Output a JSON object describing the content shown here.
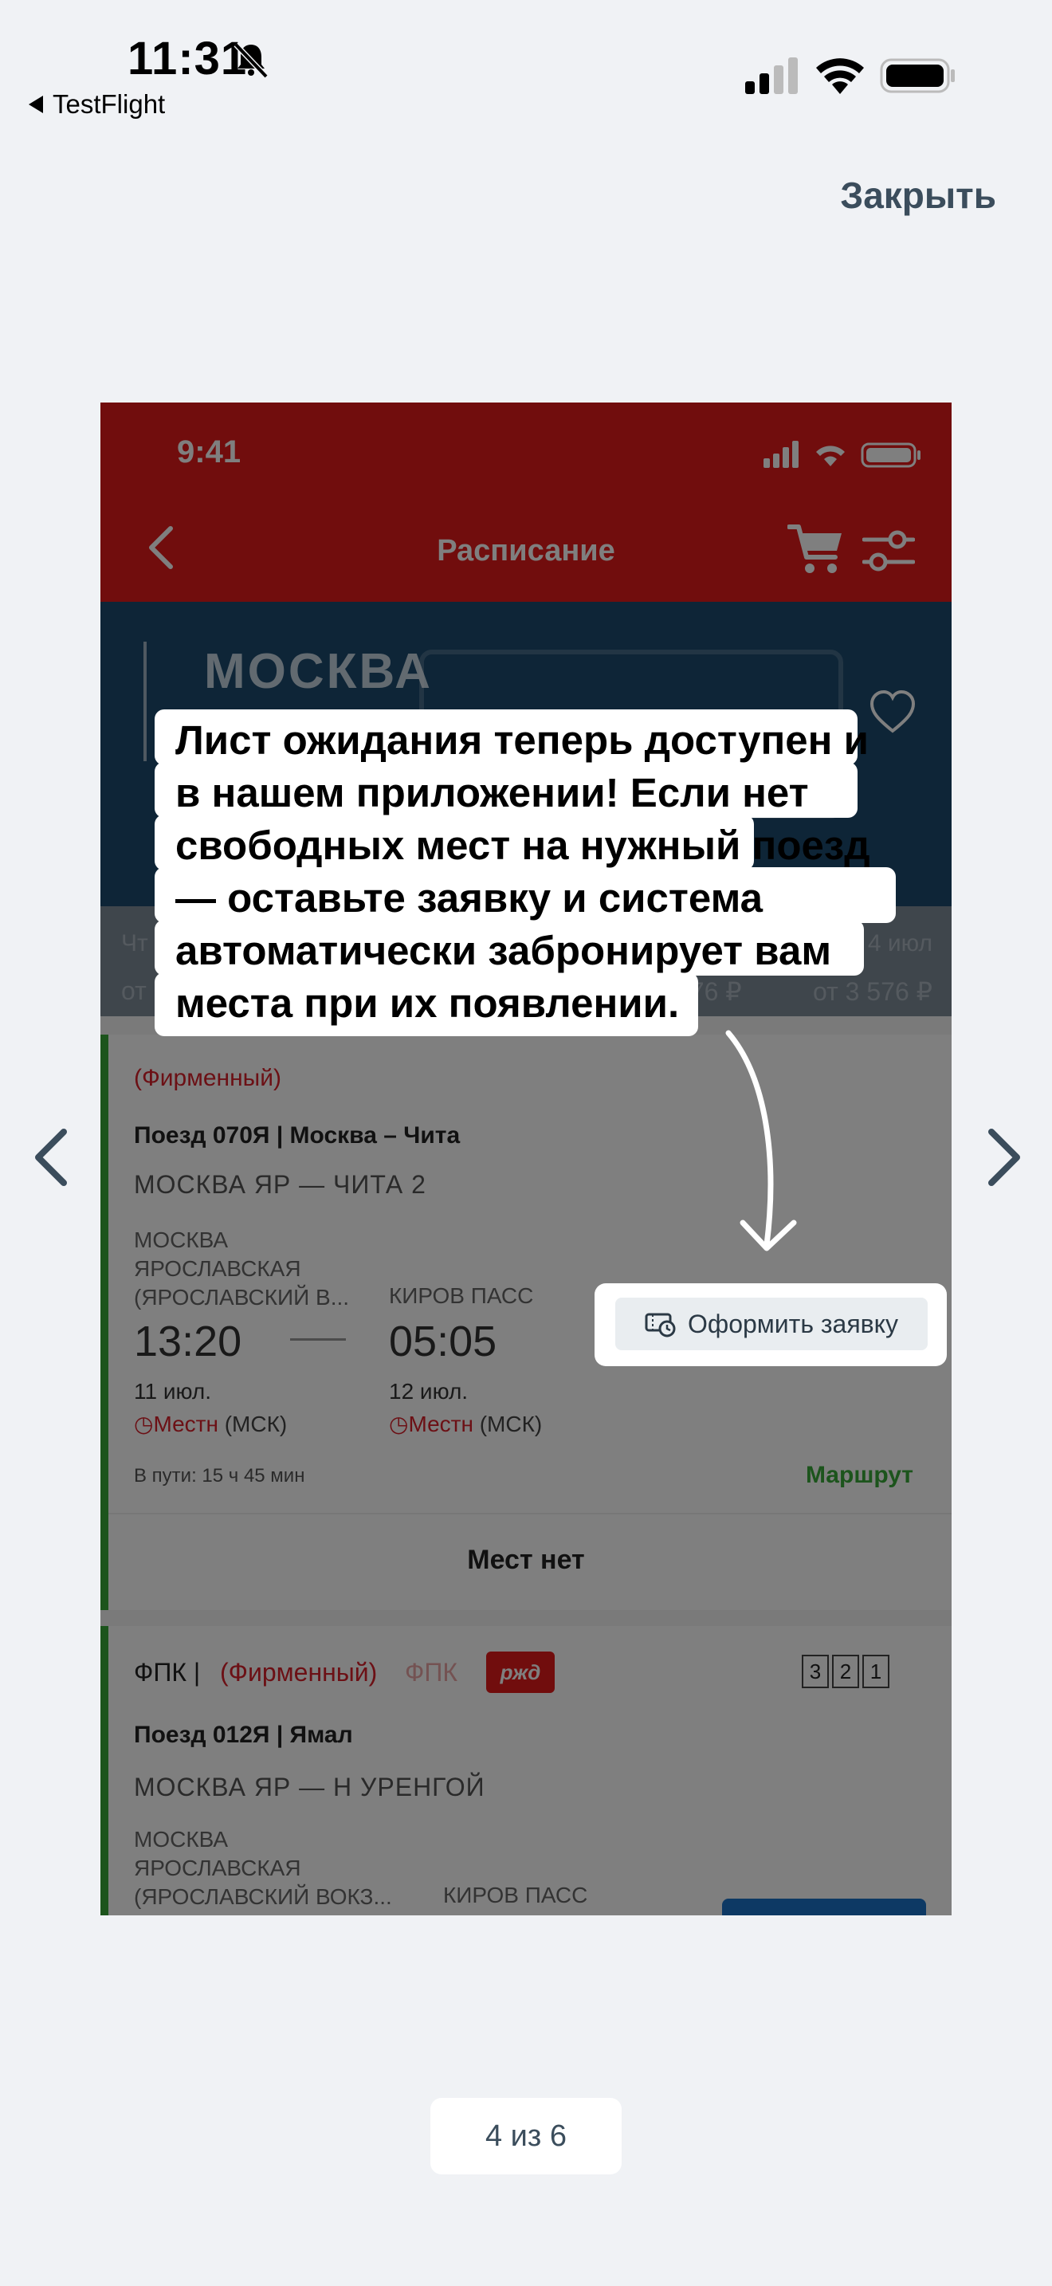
{
  "os_status": {
    "time": "11:31",
    "back_app": "TestFlight"
  },
  "viewer": {
    "close_label": "Закрыть",
    "page_indicator": "4 из 6"
  },
  "screenshot": {
    "status_time": "9:41",
    "header_title": "Расписание",
    "hero_city": "МОСКВА",
    "date_strip": {
      "left_top": "Чт",
      "left_bottom": "от",
      "mid_bottom": "576 ₽",
      "right_top": "4 июл",
      "right_bottom": "от 3 576 ₽"
    },
    "card1": {
      "badge": "(Фирменный)",
      "train": "Поезд 070Я   |   Москва – Чита",
      "route": "МОСКВА ЯР — ЧИТА 2",
      "from_station": "МОСКВА ЯРОСЛАВСКАЯ (ЯРОСЛАВСКИЙ В...",
      "to_station": "КИРОВ ПАСС",
      "dep_time": "13:20",
      "arr_time": "05:05",
      "dep_date": "11 июл.",
      "arr_date": "12 июл.",
      "tz_local": "Местн",
      "tz_msk": " (МСК)",
      "duration": "В пути: 15 ч 45 мин",
      "route_link": "Маршрут",
      "no_seats": "Мест нет"
    },
    "card2": {
      "carrier": "ФПК  |",
      "badge": "(Фирменный)",
      "fpk": "ФПК",
      "logo": "ржд",
      "classes": [
        "3",
        "2",
        "1"
      ],
      "train": "Поезд 012Я   |   Ямал",
      "route": "МОСКВА ЯР — Н УРЕНГОЙ",
      "from_station": "МОСКВА ЯРОСЛАВСКАЯ (ЯРОСЛАВСКИЙ ВОКЗ...",
      "to_station": "КИРОВ ПАСС"
    }
  },
  "callout": {
    "text": "Лист ожидания теперь доступен и в нашем приложении! Если нет свободных мест на нужный поезд — оставьте заявку и система автоматически забронирует вам места при их появлении."
  },
  "cta": {
    "label": "Оформить заявку"
  }
}
